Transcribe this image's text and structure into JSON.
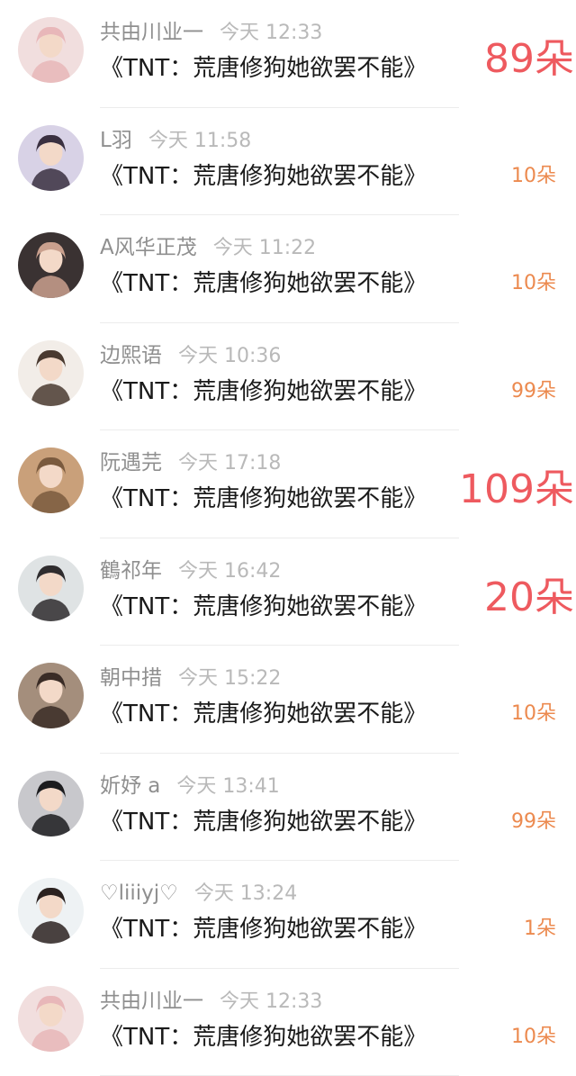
{
  "rows": [
    {
      "name": "共由川业一",
      "time": "今天 12:33",
      "title": "《TNT：荒唐修狗她欲罢不能》",
      "gift": "89朵",
      "highlight": true,
      "avatar": "avatar-girl-pink",
      "colors": [
        "#f1dede",
        "#e8b7b9"
      ]
    },
    {
      "name": "L羽",
      "time": "今天 11:58",
      "title": "《TNT：荒唐修狗她欲罢不能》",
      "gift": "10朵",
      "highlight": false,
      "avatar": "avatar-boy-purple",
      "colors": [
        "#d8d2e6",
        "#3a3040"
      ]
    },
    {
      "name": "A风华正茂",
      "time": "今天 11:22",
      "title": "《TNT：荒唐修狗她欲罢不能》",
      "gift": "10朵",
      "highlight": false,
      "avatar": "avatar-boy-dark",
      "colors": [
        "#3a3232",
        "#caa08e"
      ]
    },
    {
      "name": "边熙语",
      "time": "今天 10:36",
      "title": "《TNT：荒唐修狗她欲罢不能》",
      "gift": "99朵",
      "highlight": false,
      "avatar": "avatar-girl-light",
      "colors": [
        "#f2ede8",
        "#4a3a30"
      ]
    },
    {
      "name": "阮遇芫",
      "time": "今天 17:18",
      "title": "《TNT：荒唐修狗她欲罢不能》",
      "gift": "109朵",
      "highlight": true,
      "avatar": "avatar-girl-sunset",
      "colors": [
        "#c9a07a",
        "#7a5a3e"
      ]
    },
    {
      "name": "鶴祁年",
      "time": "今天 16:42",
      "title": "《TNT：荒唐修狗她欲罢不能》",
      "gift": "20朵",
      "highlight": true,
      "avatar": "avatar-boy-ink",
      "colors": [
        "#dfe3e4",
        "#2f2c2e"
      ]
    },
    {
      "name": "朝中措",
      "time": "今天 15:22",
      "title": "《TNT：荒唐修狗她欲罢不能》",
      "gift": "10朵",
      "highlight": false,
      "avatar": "avatar-girl-vintage",
      "colors": [
        "#a48e7c",
        "#3a2c26"
      ]
    },
    {
      "name": "妡妤 a",
      "time": "今天 13:41",
      "title": "《TNT：荒唐修狗她欲罢不能》",
      "gift": "99朵",
      "highlight": false,
      "avatar": "avatar-girl-black",
      "colors": [
        "#c8c8cc",
        "#1c1c1e"
      ]
    },
    {
      "name": "♡liiiyj♡",
      "time": "今天 13:24",
      "title": "《TNT：荒唐修狗她欲罢不能》",
      "gift": "1朵",
      "highlight": false,
      "avatar": "avatar-girl-smile",
      "colors": [
        "#eef2f4",
        "#2b2220"
      ]
    },
    {
      "name": "共由川业一",
      "time": "今天 12:33",
      "title": "《TNT：荒唐修狗她欲罢不能》",
      "gift": "10朵",
      "highlight": false,
      "avatar": "avatar-girl-pink",
      "colors": [
        "#f1dede",
        "#e8b7b9"
      ]
    }
  ]
}
